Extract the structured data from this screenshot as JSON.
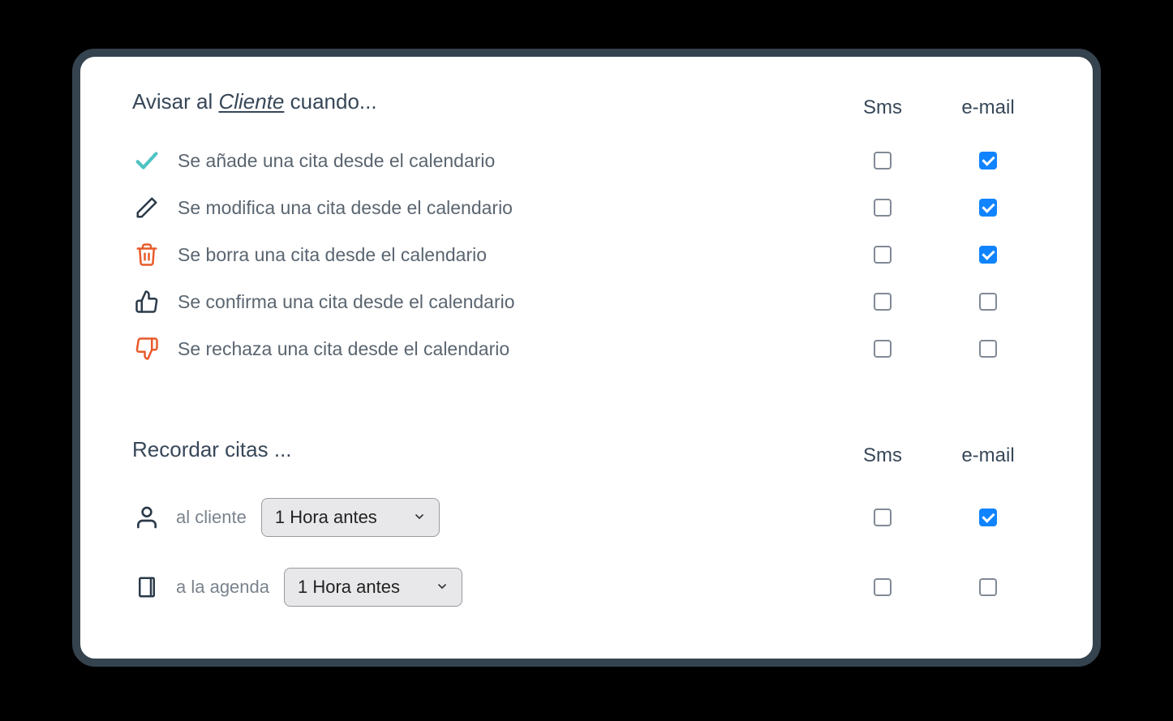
{
  "notify": {
    "title_prefix": "Avisar al ",
    "title_emph": "Cliente",
    "title_suffix": " cuando...",
    "sms_header": "Sms",
    "email_header": "e-mail",
    "rows": [
      {
        "label": "Se añade una cita desde el calendario",
        "sms": false,
        "email": true
      },
      {
        "label": "Se modifica una cita desde el calendario",
        "sms": false,
        "email": true
      },
      {
        "label": "Se borra una cita desde el calendario",
        "sms": false,
        "email": true
      },
      {
        "label": "Se confirma una cita desde el calendario",
        "sms": false,
        "email": false
      },
      {
        "label": "Se rechaza una cita desde el calendario",
        "sms": false,
        "email": false
      }
    ]
  },
  "remind": {
    "title": "Recordar citas ...",
    "sms_header": "Sms",
    "email_header": "e-mail",
    "rows": [
      {
        "label": "al cliente",
        "select_value": "1 Hora antes",
        "sms": false,
        "email": true
      },
      {
        "label": "a la agenda",
        "select_value": "1 Hora antes",
        "sms": false,
        "email": false
      }
    ]
  }
}
